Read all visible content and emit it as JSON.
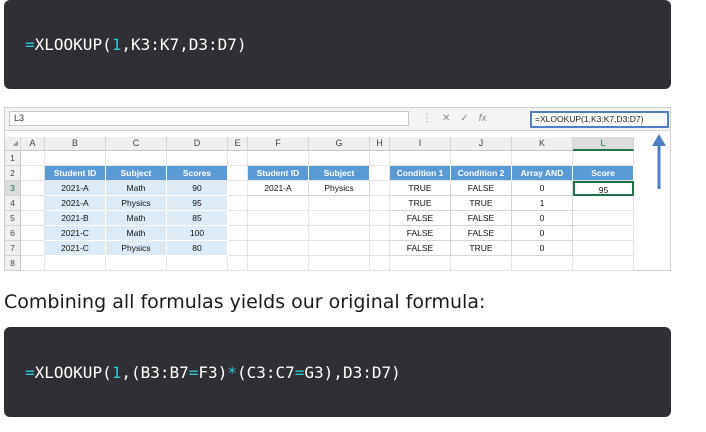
{
  "code_top": {
    "tokens": [
      {
        "t": "=",
        "c": "op"
      },
      {
        "t": "XLOOKUP(",
        "c": "txt"
      },
      {
        "t": "1",
        "c": "num"
      },
      {
        "t": ",K3:K7,D3:D7)",
        "c": "txt"
      }
    ]
  },
  "excel": {
    "name_box": "L3",
    "formula_bar": "=XLOOKUP(1,K3:K7,D3:D7)",
    "fb_icons": [
      "⋮",
      "✕",
      "✓",
      "fx"
    ],
    "columns": [
      "A",
      "B",
      "C",
      "D",
      "E",
      "F",
      "G",
      "H",
      "I",
      "J",
      "K",
      "L"
    ],
    "selected_column": "L",
    "rows": [
      "1",
      "2",
      "3",
      "4",
      "5",
      "6",
      "7",
      "8"
    ],
    "selected_row": "3",
    "table_left": {
      "headers": [
        "Student ID",
        "Subject",
        "Scores"
      ],
      "data": [
        [
          "2021-A",
          "Math",
          "90"
        ],
        [
          "2021-A",
          "Physics",
          "95"
        ],
        [
          "2021-B",
          "Math",
          "85"
        ],
        [
          "2021-C",
          "Math",
          "100"
        ],
        [
          "2021-C",
          "Physics",
          "80"
        ]
      ]
    },
    "table_lookup": {
      "headers": [
        "Student ID",
        "Subject"
      ],
      "data": [
        [
          "2021-A",
          "Physics"
        ]
      ]
    },
    "table_conditions": {
      "headers": [
        "Condition 1",
        "Condition 2",
        "Array AND"
      ],
      "data": [
        [
          "TRUE",
          "FALSE",
          "0"
        ],
        [
          "TRUE",
          "TRUE",
          "1"
        ],
        [
          "FALSE",
          "FALSE",
          "0"
        ],
        [
          "FALSE",
          "FALSE",
          "0"
        ],
        [
          "FALSE",
          "TRUE",
          "0"
        ]
      ]
    },
    "table_score": {
      "header": "Score",
      "value": "95"
    },
    "colors": {
      "header_blue": "#5b9bd5",
      "light_blue": "#ddebf7",
      "accent_green": "#217346",
      "arrow_blue": "#4e7fc3"
    }
  },
  "paragraph": "Combining all formulas yields our original formula:",
  "code_bottom": {
    "tokens": [
      {
        "t": "=",
        "c": "op"
      },
      {
        "t": "XLOOKUP(",
        "c": "txt"
      },
      {
        "t": "1",
        "c": "num"
      },
      {
        "t": ",(B3:B7",
        "c": "txt"
      },
      {
        "t": "=",
        "c": "op"
      },
      {
        "t": "F3)",
        "c": "txt"
      },
      {
        "t": "*",
        "c": "op"
      },
      {
        "t": "(C3:C7",
        "c": "txt"
      },
      {
        "t": "=",
        "c": "op"
      },
      {
        "t": "G3),D3:D7)",
        "c": "txt"
      }
    ]
  }
}
